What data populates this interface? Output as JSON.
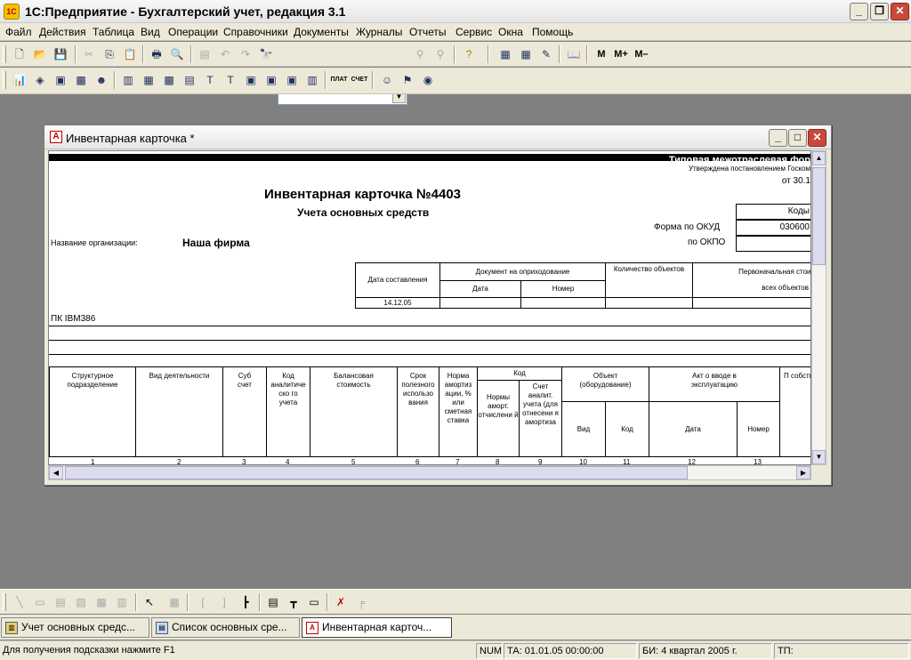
{
  "app": {
    "title": "1С:Предприятие - Бухгалтерский учет, редакция 3.1",
    "icon": "1C"
  },
  "window_buttons": {
    "minimize": "_",
    "restore": "❐",
    "close": "✕"
  },
  "menu": [
    "Файл",
    "Действия",
    "Таблица",
    "Вид",
    "Операции",
    "Справочники",
    "Документы",
    "Журналы",
    "Отчеты",
    "Сервис",
    "Окна",
    "Помощь"
  ],
  "toolbar1": {
    "search_value": "",
    "calc_labels": [
      "M",
      "M+",
      "M–"
    ]
  },
  "toolbar2": {
    "text_buttons": [
      "ПЛАТ",
      "СЧЕТ"
    ]
  },
  "doc_window": {
    "title": "Инвентарная карточка  *",
    "icon": "A"
  },
  "form": {
    "typical_form": "Типовая межотраслевая фор",
    "approved": "Утверждена постановлением Госком",
    "approved_date": "от 30.1",
    "title": "Инвентарная карточка №4403",
    "subtitle": "Учета основных средств",
    "codes_header": "Коды",
    "okud_label": "Форма по ОКУД",
    "okud_value": "030600",
    "okpo_label": "по ОКПО",
    "okpo_value": "",
    "org_label": "Название организации:",
    "org_value": "Наша фирма",
    "header_table": {
      "date_col": "Дата составления",
      "doc_col": "Документ на оприходование",
      "doc_date": "Дата",
      "doc_number": "Номер",
      "qty_col": "Количество объектов",
      "cost_col": "Первоначальная стоим",
      "cost_sub": "всех объектов",
      "date_value": "14.12.05"
    },
    "object_name": "ПК IBM386",
    "main_table": {
      "columns": [
        "Структурное подразделение",
        "Вид деятельности",
        "Суб счет",
        "Код аналитиче ско го учета",
        "Балансовая стоимость",
        "Срок полезного использо вания",
        "Норма амортиз ации, % или сметная ставка",
        "Код",
        "Объект (оборудование)",
        "Акт о вводе в эксплуатацию",
        "П собств"
      ],
      "code_sub": [
        "Нормы аморт. отчислени й",
        "Счет аналит. учета (для отнесени я амортиза"
      ],
      "object_sub": [
        "Вид",
        "Код"
      ],
      "act_sub": [
        "Дата",
        "Номер"
      ],
      "numbers": [
        "1",
        "2",
        "3",
        "4",
        "5",
        "6",
        "7",
        "8",
        "9",
        "10",
        "11",
        "12",
        "13"
      ]
    }
  },
  "window_tabs": [
    {
      "label": "Учет основных средс...",
      "active": false
    },
    {
      "label": "Список основных сре...",
      "active": false
    },
    {
      "label": "Инвентарная карточ...",
      "active": true
    }
  ],
  "status": {
    "hint": "Для получения подсказки нажмите F1",
    "num": "NUM",
    "ta": "ТА: 01.01.05  00:00:00",
    "bi": "БИ: 4 квартал 2005 г.",
    "tp": "ТП:"
  }
}
